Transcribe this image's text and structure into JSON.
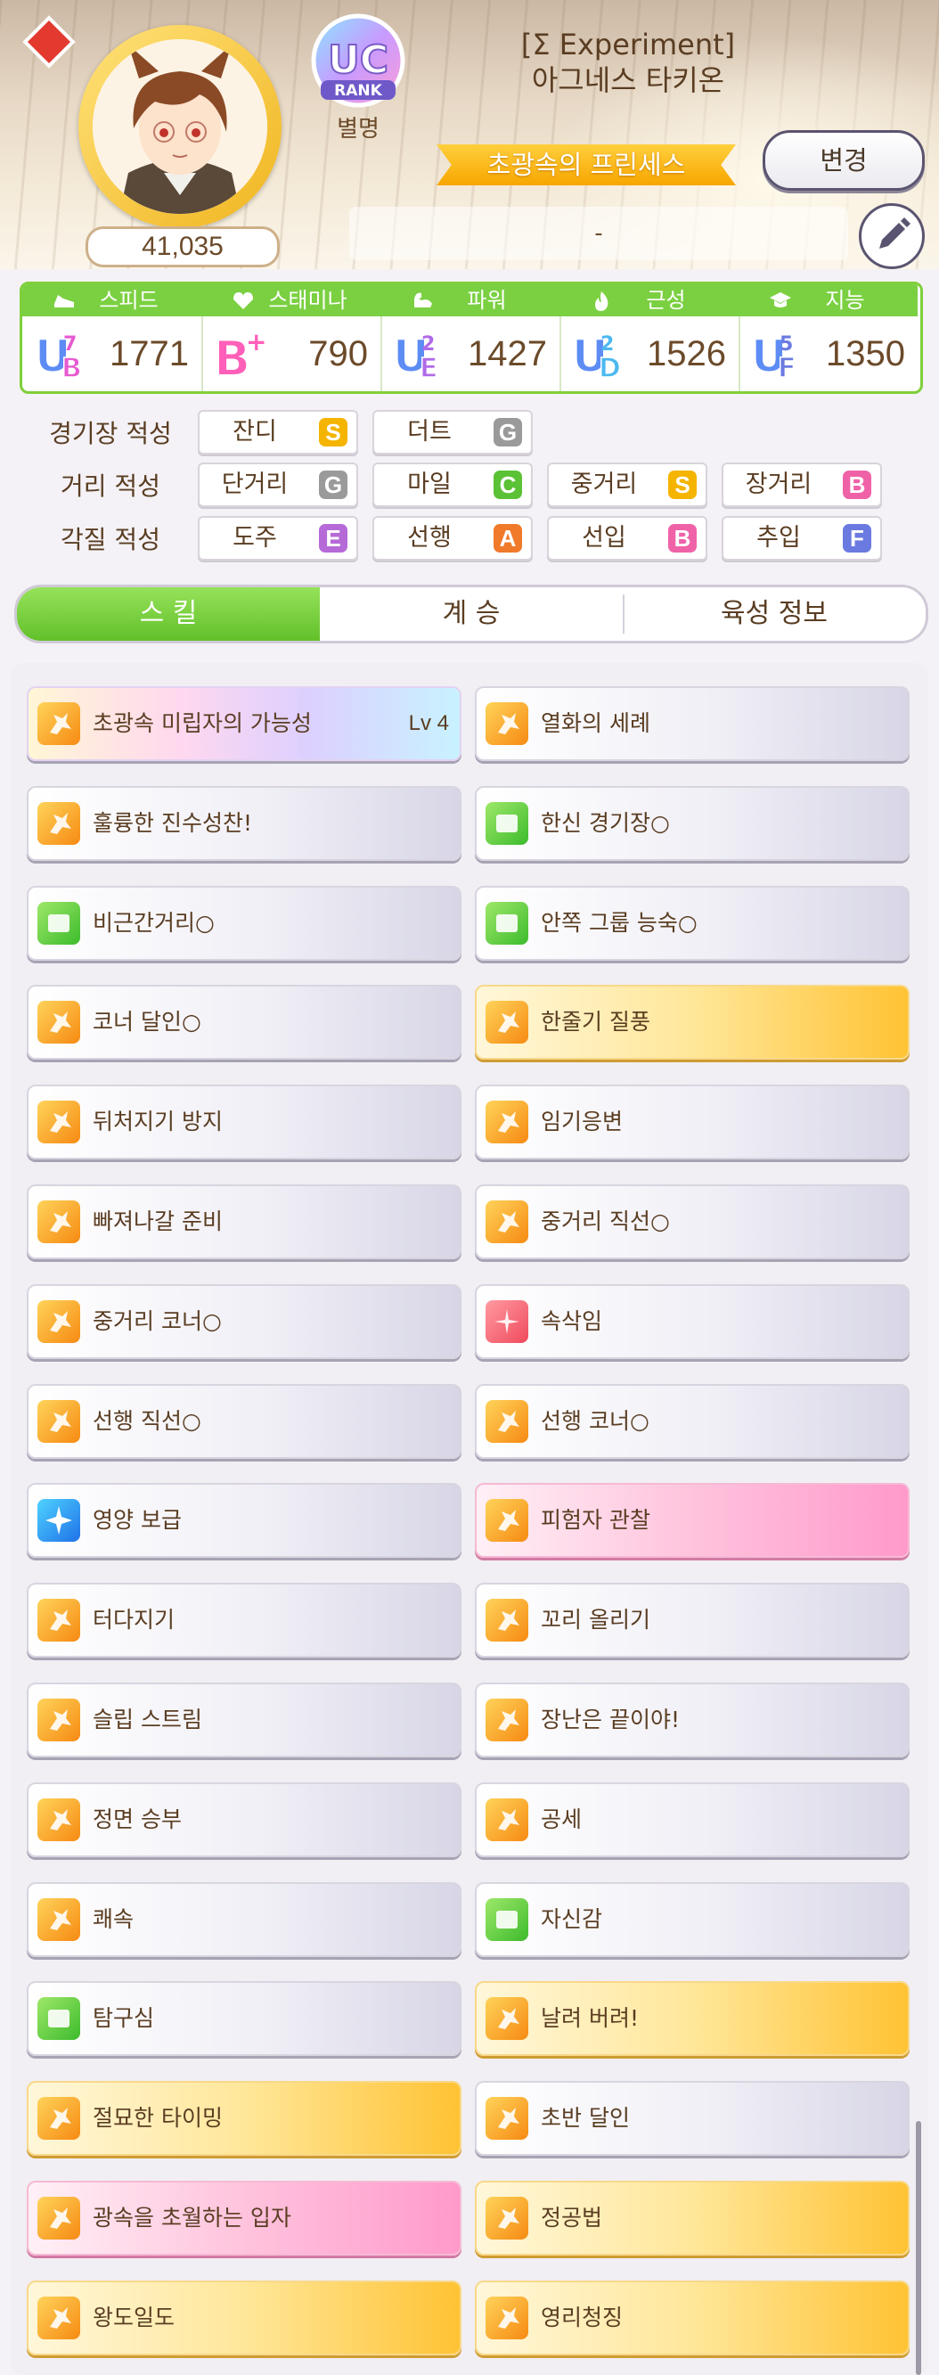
{
  "header": {
    "title_tag": "[Σ Experiment]",
    "character_name": "아그네스 타키온",
    "fans": "41,035",
    "rank_badge": "UC",
    "rank_word": "RANK",
    "nickname_label": "별명",
    "ribbon_title": "초광속의 프린세스",
    "change_label": "변경",
    "memo_text": "-",
    "icons": {
      "diamond": "red-diamond-icon",
      "edit": "pencil-icon"
    }
  },
  "stats": [
    {
      "label": "스피드",
      "icon": "shoe-icon",
      "grade": "UB7",
      "value": "1771"
    },
    {
      "label": "스태미나",
      "icon": "heart-icon",
      "grade": "B+",
      "value": "790"
    },
    {
      "label": "파워",
      "icon": "muscle-icon",
      "grade": "UE2",
      "value": "1427"
    },
    {
      "label": "근성",
      "icon": "flame-icon",
      "grade": "UD2",
      "value": "1526"
    },
    {
      "label": "지능",
      "icon": "graduation-cap-icon",
      "grade": "UF5",
      "value": "1350"
    }
  ],
  "aptitude": {
    "track_label": "경기장 적성",
    "distance_label": "거리 적성",
    "style_label": "각질 적성",
    "track": [
      {
        "name": "잔디",
        "grade": "S",
        "color": "#f4b400"
      },
      {
        "name": "더트",
        "grade": "G",
        "color": "#9a9a9a"
      }
    ],
    "distance": [
      {
        "name": "단거리",
        "grade": "G",
        "color": "#9a9a9a"
      },
      {
        "name": "마일",
        "grade": "C",
        "color": "#5bc236"
      },
      {
        "name": "중거리",
        "grade": "S",
        "color": "#f4b400"
      },
      {
        "name": "장거리",
        "grade": "B",
        "color": "#f062a8"
      }
    ],
    "style": [
      {
        "name": "도주",
        "grade": "E",
        "color": "#b56ad8"
      },
      {
        "name": "선행",
        "grade": "A",
        "color": "#f07a2a"
      },
      {
        "name": "선입",
        "grade": "B",
        "color": "#f062a8"
      },
      {
        "name": "추입",
        "grade": "F",
        "color": "#6a7ae0"
      }
    ]
  },
  "tabs": [
    {
      "label": "스 킬",
      "active": true
    },
    {
      "label": "계 승",
      "active": false
    },
    {
      "label": "육성 정보",
      "active": false
    }
  ],
  "skills": [
    {
      "name": "초광속 미립자의 가능성",
      "level": "Lv 4",
      "style": "rainbow",
      "icon": "orange"
    },
    {
      "name": "열화의 세례",
      "level": "",
      "style": "normal",
      "icon": "orange"
    },
    {
      "name": "훌륭한 진수성찬!",
      "level": "",
      "style": "normal",
      "icon": "orange"
    },
    {
      "name": "한신 경기장○",
      "level": "",
      "style": "normal",
      "icon": "green"
    },
    {
      "name": "비근간거리○",
      "level": "",
      "style": "normal",
      "icon": "green"
    },
    {
      "name": "안쪽 그룹 능숙○",
      "level": "",
      "style": "normal",
      "icon": "green"
    },
    {
      "name": "코너 달인○",
      "level": "",
      "style": "normal",
      "icon": "orange"
    },
    {
      "name": "한줄기 질풍",
      "level": "",
      "style": "gold",
      "icon": "orange"
    },
    {
      "name": "뒤처지기 방지",
      "level": "",
      "style": "normal",
      "icon": "orange"
    },
    {
      "name": "임기응변",
      "level": "",
      "style": "normal",
      "icon": "orange"
    },
    {
      "name": "빠져나갈 준비",
      "level": "",
      "style": "normal",
      "icon": "orange"
    },
    {
      "name": "중거리 직선○",
      "level": "",
      "style": "normal",
      "icon": "orange"
    },
    {
      "name": "중거리 코너○",
      "level": "",
      "style": "normal",
      "icon": "orange"
    },
    {
      "name": "속삭임",
      "level": "",
      "style": "normal",
      "icon": "red"
    },
    {
      "name": "선행 직선○",
      "level": "",
      "style": "normal",
      "icon": "orange"
    },
    {
      "name": "선행 코너○",
      "level": "",
      "style": "normal",
      "icon": "orange"
    },
    {
      "name": "영양 보급",
      "level": "",
      "style": "normal",
      "icon": "blue"
    },
    {
      "name": "피험자 관찰",
      "level": "",
      "style": "pink",
      "icon": "orange"
    },
    {
      "name": "터다지기",
      "level": "",
      "style": "normal",
      "icon": "orange"
    },
    {
      "name": "꼬리 올리기",
      "level": "",
      "style": "normal",
      "icon": "orange"
    },
    {
      "name": "슬립 스트림",
      "level": "",
      "style": "normal",
      "icon": "orange"
    },
    {
      "name": "장난은 끝이야!",
      "level": "",
      "style": "normal",
      "icon": "orange"
    },
    {
      "name": "정면 승부",
      "level": "",
      "style": "normal",
      "icon": "orange"
    },
    {
      "name": "공세",
      "level": "",
      "style": "normal",
      "icon": "orange"
    },
    {
      "name": "쾌속",
      "level": "",
      "style": "normal",
      "icon": "orange"
    },
    {
      "name": "자신감",
      "level": "",
      "style": "normal",
      "icon": "green"
    },
    {
      "name": "탐구심",
      "level": "",
      "style": "normal",
      "icon": "green"
    },
    {
      "name": "날려 버려!",
      "level": "",
      "style": "gold",
      "icon": "orange"
    },
    {
      "name": "절묘한 타이밍",
      "level": "",
      "style": "gold",
      "icon": "orange"
    },
    {
      "name": "초반 달인",
      "level": "",
      "style": "normal",
      "icon": "orange"
    },
    {
      "name": "광속을 초월하는 입자",
      "level": "",
      "style": "pink",
      "icon": "orange"
    },
    {
      "name": "정공법",
      "level": "",
      "style": "gold",
      "icon": "orange"
    },
    {
      "name": "왕도일도",
      "level": "",
      "style": "gold",
      "icon": "orange"
    },
    {
      "name": "영리청징",
      "level": "",
      "style": "gold",
      "icon": "orange"
    }
  ]
}
